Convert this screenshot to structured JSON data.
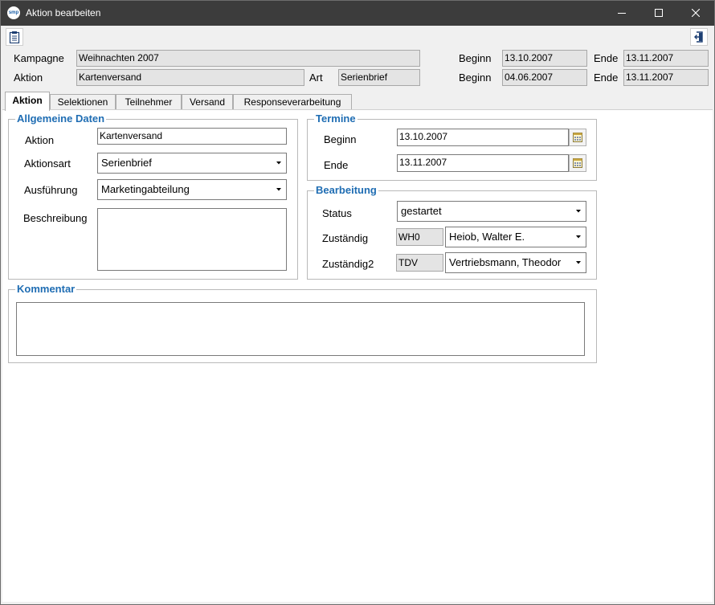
{
  "window": {
    "title": "Aktion bearbeiten",
    "logo_text": "smp"
  },
  "header": {
    "kampagne_label": "Kampagne",
    "kampagne_value": "Weihnachten 2007",
    "aktion_label": "Aktion",
    "aktion_value": "Kartenversand",
    "art_label": "Art",
    "art_value": "Serienbrief",
    "kampagne_beginn_label": "Beginn",
    "kampagne_beginn_value": "13.10.2007",
    "kampagne_ende_label": "Ende",
    "kampagne_ende_value": "13.11.2007",
    "aktion_beginn_label": "Beginn",
    "aktion_beginn_value": "04.06.2007",
    "aktion_ende_label": "Ende",
    "aktion_ende_value": "13.11.2007"
  },
  "tabs": [
    {
      "label": "Aktion"
    },
    {
      "label": "Selektionen"
    },
    {
      "label": "Teilnehmer"
    },
    {
      "label": "Versand"
    },
    {
      "label": "Responseverarbeitung"
    }
  ],
  "allgemein": {
    "legend": "Allgemeine Daten",
    "aktion_label": "Aktion",
    "aktion_value": "Kartenversand",
    "aktionsart_label": "Aktionsart",
    "aktionsart_value": "Serienbrief",
    "ausfuehrung_label": "Ausführung",
    "ausfuehrung_value": "Marketingabteilung",
    "beschreibung_label": "Beschreibung",
    "beschreibung_value": ""
  },
  "termine": {
    "legend": "Termine",
    "beginn_label": "Beginn",
    "beginn_value": "13.10.2007",
    "ende_label": "Ende",
    "ende_value": "13.11.2007"
  },
  "bearbeitung": {
    "legend": "Bearbeitung",
    "status_label": "Status",
    "status_value": "gestartet",
    "zustaendig_label": "Zuständig",
    "zustaendig_code": "WH0",
    "zustaendig_value": "Heiob, Walter E.",
    "zustaendig2_label": "Zuständig2",
    "zustaendig2_code": "TDV",
    "zustaendig2_value": "Vertriebsmann, Theodor"
  },
  "kommentar": {
    "legend": "Kommentar",
    "value": ""
  },
  "icons": {
    "toolbar_left": "clipboard-icon",
    "toolbar_right": "exit-icon",
    "calendar": "calendar-icon",
    "dropdown": "chevron-down-icon"
  },
  "colors": {
    "legend": "#1f6db3",
    "titlebar": "#3c3c3c"
  }
}
